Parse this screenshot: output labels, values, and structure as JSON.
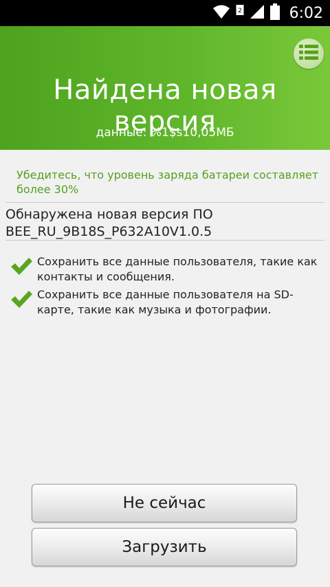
{
  "status_bar": {
    "time": "6:02",
    "icons": [
      "wifi-icon",
      "sim-icon",
      "signal-icon",
      "battery-icon"
    ]
  },
  "header": {
    "title": "Найдена новая версия",
    "subtitle": "данные: %1$s10,05МБ",
    "menu_icon": "list-menu-icon"
  },
  "warning": {
    "text": "Убедитесь, что уровень заряда батареи составляет более 30%"
  },
  "update": {
    "line1": "Обнаружена новая версия ПО",
    "line2": "BEE_RU_9B18S_P632A10V1.0.5"
  },
  "checklist": [
    "Сохранить все данные пользователя, такие как контакты и сообщения.",
    "Сохранить все данные пользователя на SD-карте, такие как музыка и фотографии."
  ],
  "buttons": {
    "not_now": "Не сейчас",
    "download": "Загрузить"
  },
  "colors": {
    "header_green": "#5fb62a",
    "warning_green": "#55a01f",
    "check_green": "#5aa51f"
  }
}
